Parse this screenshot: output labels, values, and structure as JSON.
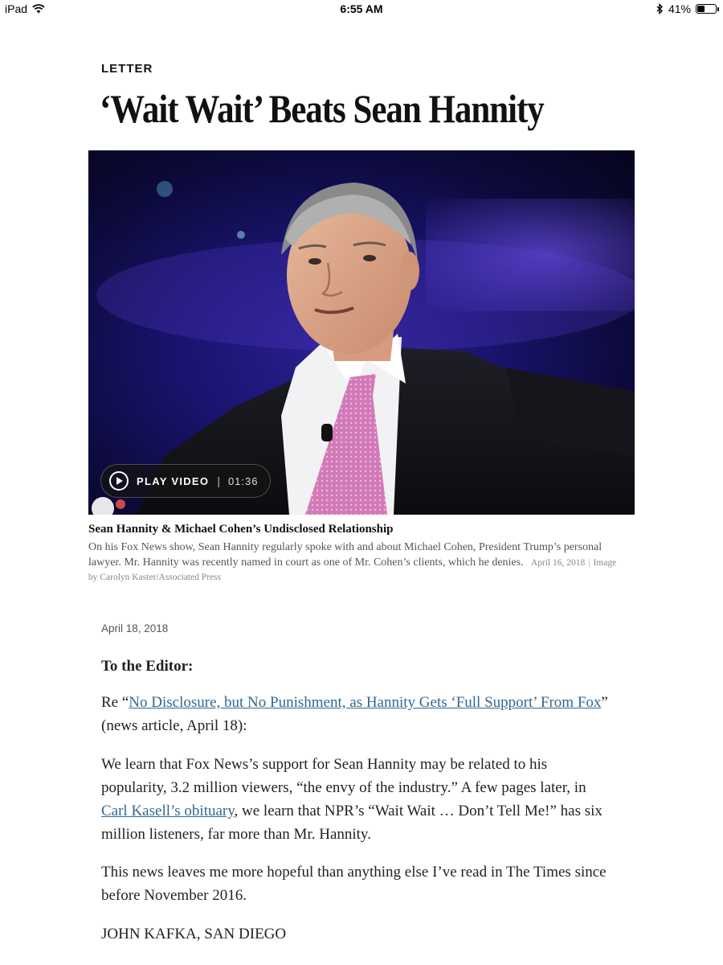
{
  "status_bar": {
    "device": "iPad",
    "time": "6:55 AM",
    "battery_percent": "41%",
    "battery_level": 0.41,
    "wifi_icon": "wifi-icon",
    "bluetooth_icon": "bluetooth-icon"
  },
  "article": {
    "kicker": "LETTER",
    "headline": "‘Wait Wait’ Beats Sean Hannity",
    "date": "April 18, 2018",
    "greeting": "To the Editor:",
    "p1": {
      "prefix": "Re “",
      "link_text": "No Disclosure, but No Punishment, as Hannity Gets ‘Full Support’ From Fox",
      "suffix": "” (news article, April 18):"
    },
    "p2": {
      "before": "We learn that Fox News’s support for Sean Hannity may be related to his popularity, 3.2 million viewers, “the envy of the industry.” A few pages later, in ",
      "link_text": "Carl Kasell’s obituary",
      "after": ", we learn that NPR’s “Wait Wait … Don’t Tell Me!” has six million listeners, far more than Mr. Hannity."
    },
    "p3": "This news leaves me more hopeful than anything else I’ve read in The Times since before November 2016.",
    "signoff": "JOHN KAFKA, SAN DIEGO"
  },
  "video": {
    "play_label": "PLAY VIDEO",
    "separator": "|",
    "duration": "01:36",
    "play_icon": "play-circle-icon",
    "caption_title": "Sean Hannity & Michael Cohen’s Undisclosed Relationship",
    "caption_body": "On his Fox News show, Sean Hannity regularly spoke with and about Michael Cohen, President Trump’s personal lawyer. Mr. Hannity was recently named in court as one of Mr. Cohen’s clients, which he denies.",
    "caption_date": "April 16, 2018",
    "caption_credit": "Image by Carolyn Kaster/Associated Press"
  }
}
